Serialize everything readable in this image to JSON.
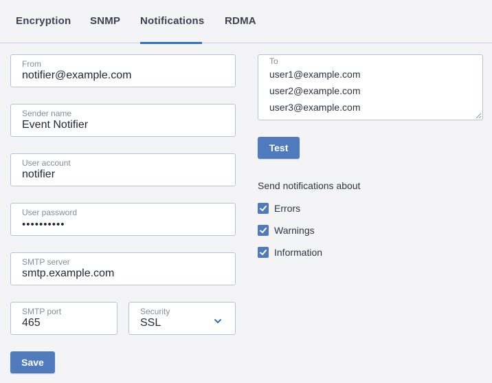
{
  "tabs": [
    {
      "label": "Encryption",
      "active": false
    },
    {
      "label": "SNMP",
      "active": false
    },
    {
      "label": "Notifications",
      "active": true
    },
    {
      "label": "RDMA",
      "active": false
    }
  ],
  "form": {
    "from": {
      "label": "From",
      "value": "notifier@example.com"
    },
    "sender_name": {
      "label": "Sender name",
      "value": "Event Notifier"
    },
    "user_account": {
      "label": "User account",
      "value": "notifier"
    },
    "user_password": {
      "label": "User password",
      "value": "••••••••••"
    },
    "smtp_server": {
      "label": "SMTP server",
      "value": "smtp.example.com"
    },
    "smtp_port": {
      "label": "SMTP port",
      "value": "465"
    },
    "security": {
      "label": "Security",
      "value": "SSL",
      "icon": "chevron-down-icon"
    },
    "to": {
      "label": "To",
      "lines": [
        "user1@example.com",
        "user2@example.com",
        "user3@example.com"
      ]
    }
  },
  "buttons": {
    "test": "Test",
    "save": "Save"
  },
  "notifications": {
    "title": "Send notifications about",
    "options": [
      {
        "label": "Errors",
        "checked": true
      },
      {
        "label": "Warnings",
        "checked": true
      },
      {
        "label": "Information",
        "checked": true
      }
    ]
  },
  "colors": {
    "accent": "#4f7bbd",
    "tab_underline": "#2f6fc9",
    "background": "#f4f4f6"
  }
}
